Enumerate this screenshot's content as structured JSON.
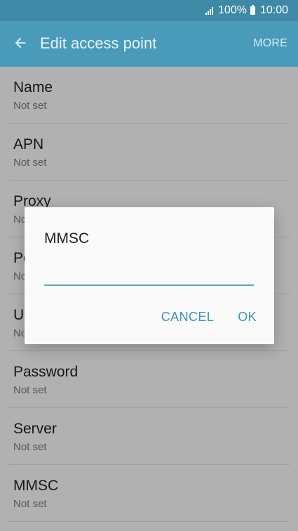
{
  "statusbar": {
    "battery_percent": "100%",
    "time": "10:00",
    "icons": [
      "signal-icon",
      "battery-icon"
    ]
  },
  "toolbar": {
    "back_icon": "arrow-left-icon",
    "title": "Edit access point",
    "more_label": "MORE"
  },
  "list": {
    "items": [
      {
        "label": "Name",
        "value": "Not set"
      },
      {
        "label": "APN",
        "value": "Not set"
      },
      {
        "label": "Proxy",
        "value": "Not set"
      },
      {
        "label": "Port",
        "value": "Not set"
      },
      {
        "label": "Username",
        "value": "Not set"
      },
      {
        "label": "Password",
        "value": "Not set"
      },
      {
        "label": "Server",
        "value": "Not set"
      },
      {
        "label": "MMSC",
        "value": "Not set"
      }
    ]
  },
  "dialog": {
    "title": "MMSC",
    "input_value": "",
    "cancel_label": "CANCEL",
    "ok_label": "OK"
  },
  "colors": {
    "statusbar": "#3e8aa6",
    "toolbar": "#4a9bb9",
    "accent": "#3f93b3"
  }
}
